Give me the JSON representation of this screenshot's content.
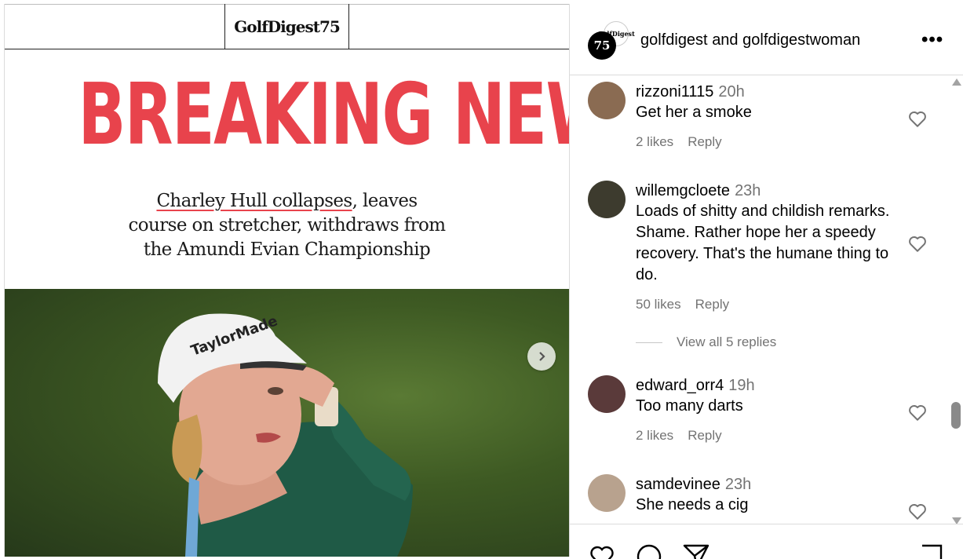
{
  "post": {
    "masthead": "GolfDigest75",
    "headline": "BREAKING NEWS",
    "subhead": {
      "underlined": "Charley Hull collapses",
      "line1_rest": ", leaves",
      "line2": "course on stretcher, withdraws from",
      "line3": "the Amundi Evian Championship"
    },
    "next_icon": "chevron-right-icon"
  },
  "header": {
    "avatar_text": "75",
    "avatar2_text": "GolfDigest",
    "user1": "golfdigest",
    "joiner": "and",
    "user2": "golfdigestwoman",
    "more_icon": "more-horizontal-icon",
    "more_label": "•••"
  },
  "comments": [
    {
      "user": "rizzoni1115",
      "time": "20h",
      "text": "Get her a smoke",
      "likes": "2 likes",
      "reply": "Reply"
    },
    {
      "user": "willemgcloete",
      "time": "23h",
      "text": "Loads of shitty and childish remarks. Shame. Rather hope her a speedy recovery. That's the humane thing to do.",
      "likes": "50 likes",
      "reply": "Reply",
      "view_replies": "View all 5 replies"
    },
    {
      "user": "edward_orr4",
      "time": "19h",
      "text": "Too many darts",
      "likes": "2 likes",
      "reply": "Reply"
    },
    {
      "user": "samdevinee",
      "time": "23h",
      "text": "She needs a cig"
    }
  ],
  "colors": {
    "headline_red": "#e8434c",
    "muted": "#737373"
  }
}
